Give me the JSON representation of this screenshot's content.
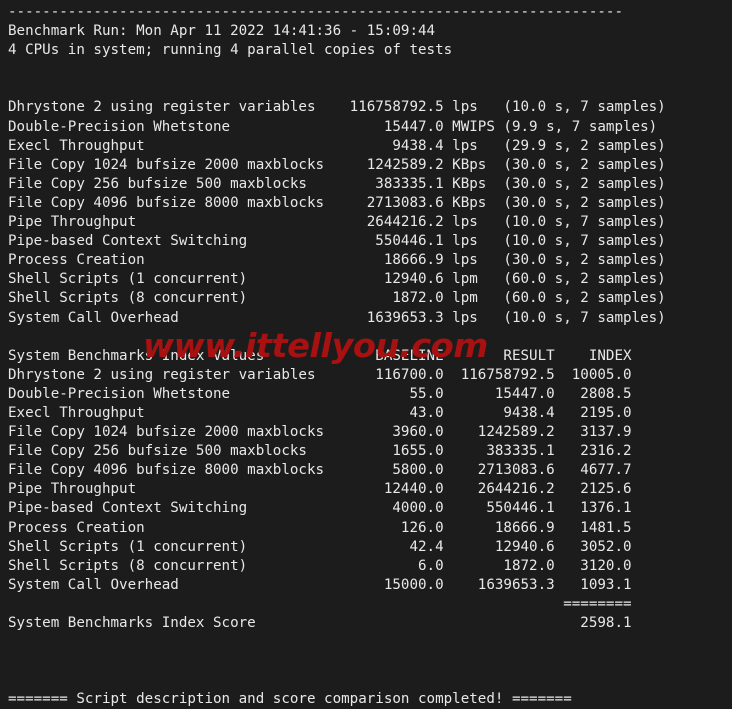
{
  "terminal": {
    "background_color": "#1c1c1c",
    "text_color": "#e8e8e8",
    "separator_top": "------------------------------------------------------------------------",
    "header": {
      "run_line": "Benchmark Run: Mon Apr 11 2022 14:41:36 - 15:09:44",
      "cpu_line": "4 CPUs in system; running 4 parallel copies of tests"
    },
    "results": {
      "rows": [
        {
          "test": "Dhrystone 2 using register variables",
          "value": "116758792.5",
          "unit": "lps",
          "timing": "(10.0 s, 7 samples)"
        },
        {
          "test": "Double-Precision Whetstone",
          "value": "15447.0",
          "unit": "MWIPS",
          "timing": "(9.9 s, 7 samples)"
        },
        {
          "test": "Execl Throughput",
          "value": "9438.4",
          "unit": "lps",
          "timing": "(29.9 s, 2 samples)"
        },
        {
          "test": "File Copy 1024 bufsize 2000 maxblocks",
          "value": "1242589.2",
          "unit": "KBps",
          "timing": "(30.0 s, 2 samples)"
        },
        {
          "test": "File Copy 256 bufsize 500 maxblocks",
          "value": "383335.1",
          "unit": "KBps",
          "timing": "(30.0 s, 2 samples)"
        },
        {
          "test": "File Copy 4096 bufsize 8000 maxblocks",
          "value": "2713083.6",
          "unit": "KBps",
          "timing": "(30.0 s, 2 samples)"
        },
        {
          "test": "Pipe Throughput",
          "value": "2644216.2",
          "unit": "lps",
          "timing": "(10.0 s, 7 samples)"
        },
        {
          "test": "Pipe-based Context Switching",
          "value": "550446.1",
          "unit": "lps",
          "timing": "(10.0 s, 7 samples)"
        },
        {
          "test": "Process Creation",
          "value": "18666.9",
          "unit": "lps",
          "timing": "(30.0 s, 2 samples)"
        },
        {
          "test": "Shell Scripts (1 concurrent)",
          "value": "12940.6",
          "unit": "lpm",
          "timing": "(60.0 s, 2 samples)"
        },
        {
          "test": "Shell Scripts (8 concurrent)",
          "value": "1872.0",
          "unit": "lpm",
          "timing": "(60.0 s, 2 samples)"
        },
        {
          "test": "System Call Overhead",
          "value": "1639653.3",
          "unit": "lps",
          "timing": "(10.0 s, 7 samples)"
        }
      ]
    },
    "index_table": {
      "title": "System Benchmarks Index Values",
      "columns": [
        "BASELINE",
        "RESULT",
        "INDEX"
      ],
      "rows": [
        {
          "test": "Dhrystone 2 using register variables",
          "baseline": "116700.0",
          "result": "116758792.5",
          "index": "10005.0"
        },
        {
          "test": "Double-Precision Whetstone",
          "baseline": "55.0",
          "result": "15447.0",
          "index": "2808.5"
        },
        {
          "test": "Execl Throughput",
          "baseline": "43.0",
          "result": "9438.4",
          "index": "2195.0"
        },
        {
          "test": "File Copy 1024 bufsize 2000 maxblocks",
          "baseline": "3960.0",
          "result": "1242589.2",
          "index": "3137.9"
        },
        {
          "test": "File Copy 256 bufsize 500 maxblocks",
          "baseline": "1655.0",
          "result": "383335.1",
          "index": "2316.2"
        },
        {
          "test": "File Copy 4096 bufsize 8000 maxblocks",
          "baseline": "5800.0",
          "result": "2713083.6",
          "index": "4677.7"
        },
        {
          "test": "Pipe Throughput",
          "baseline": "12440.0",
          "result": "2644216.2",
          "index": "2125.6"
        },
        {
          "test": "Pipe-based Context Switching",
          "baseline": "4000.0",
          "result": "550446.1",
          "index": "1376.1"
        },
        {
          "test": "Process Creation",
          "baseline": "126.0",
          "result": "18666.9",
          "index": "1481.5"
        },
        {
          "test": "Shell Scripts (1 concurrent)",
          "baseline": "42.4",
          "result": "12940.6",
          "index": "3052.0"
        },
        {
          "test": "Shell Scripts (8 concurrent)",
          "baseline": "6.0",
          "result": "1872.0",
          "index": "3120.0"
        },
        {
          "test": "System Call Overhead",
          "baseline": "15000.0",
          "result": "1639653.3",
          "index": "1093.1"
        }
      ],
      "score_separator": "========",
      "score_label": "System Benchmarks Index Score",
      "score_value": "2598.1"
    },
    "footer": "======= Script description and score comparison completed! ======="
  },
  "watermark": {
    "text": "www.ittellyou.com",
    "color": "#a81111"
  }
}
